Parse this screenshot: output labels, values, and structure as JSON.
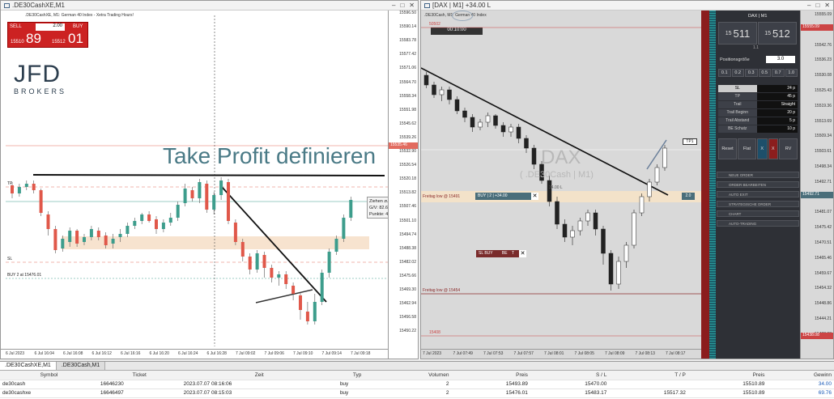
{
  "win1": {
    "title": ".DE30CashXE,M1",
    "info": ".DE30CashXE, M1: German 40 Index - Xetra Trading Hours!",
    "sell_label": "SELL",
    "buy_label": "BUY",
    "lot": "2.00",
    "sell_price_small": "15510",
    "sell_price_big": "89",
    "buy_price_small": "15512",
    "buy_price_big": "01",
    "logo_top": "JFD",
    "logo_bottom": "BROKERS",
    "overlay_text": "Take Profit definieren",
    "tooltip": [
      "Ziehen zum Ändern",
      "G/V: 82.62 EUR",
      "Punkte: 4131"
    ],
    "tp_label": "TP",
    "sl_label": "SL",
    "buy_line_label": "BUY 2 at 15476.01",
    "price_tag": "15535.46",
    "yticks": [
      "15596.50",
      "15590.14",
      "15583.78",
      "15577.42",
      "15571.06",
      "15564.70",
      "15558.34",
      "15551.98",
      "15545.62",
      "15539.26",
      "15532.90",
      "15526.54",
      "15520.18",
      "15513.82",
      "15507.46",
      "15501.10",
      "15494.74",
      "15488.38",
      "15482.02",
      "15475.66",
      "15469.30",
      "15462.94",
      "15456.58",
      "15450.22"
    ],
    "xticks": [
      "6 Jul 2023",
      "6 Jul 16:04",
      "6 Jul 16:08",
      "6 Jul 16:12",
      "6 Jul 16:16",
      "6 Jul 16:20",
      "6 Jul 16:24",
      "6 Jul 16:28",
      "7 Jul 09:02",
      "7 Jul 09:06",
      "7 Jul 09:10",
      "7 Jul 09:14",
      "7 Jul 09:18"
    ]
  },
  "win2": {
    "title": "[DAX | M1] +34.00 L",
    "info": ".DE30Cash, M1: German 40 Index",
    "timer": "00:10:00",
    "watermark_big": "DAX",
    "watermark_small": "( .DE30Cash | M1)",
    "line_top": "50502",
    "pos_label": "BUY | 2 | +34.00",
    "pos_right": "2.0",
    "pos_right2": "34.00 L",
    "sl_box": "SL BUY",
    "sl_box2": "BE",
    "t_label": "T",
    "tp_tag": "TP1",
    "day_low": "Freitag low @ 15491",
    "day_low2": "Freitag low @ 15454",
    "bottom_line": "15408",
    "yticks": [
      "15555.09",
      "15549.06",
      "15542.76",
      "15536.23",
      "15530.08",
      "15525.43",
      "15519.36",
      "15513.69",
      "15509.34",
      "15503.61",
      "15498.34",
      "15492.71",
      "15487.21",
      "15481.07",
      "15475.42",
      "15470.51",
      "15465.46",
      "15459.67",
      "15454.32",
      "15448.86",
      "15444.21",
      "15438.08"
    ],
    "ytag_top": "15555.09",
    "ytag_red": "15438.08",
    "ytag_blue": "15492.71",
    "xticks": [
      "7 Jul 2023",
      "7 Jul 07:49",
      "7 Jul 07:53",
      "7 Jul 07:57",
      "7 Jul 08:01",
      "7 Jul 08:05",
      "7 Jul 08:09",
      "7 Jul 08:13",
      "7 Jul 08:17"
    ]
  },
  "panel": {
    "symbol": "DAX | M1",
    "bid_small": "15",
    "bid_big": "511",
    "ask_small": "15",
    "ask_big": "512",
    "spread": "1.1",
    "size_label": "Positionsgröße",
    "size_val": "3.0",
    "lots": [
      "0.1",
      "0.2",
      "0.3",
      "0.5",
      "0.7",
      "1.0"
    ],
    "params": [
      {
        "k": "SL",
        "v": "24 p"
      },
      {
        "k": "TP",
        "v": "45 p"
      },
      {
        "k": "Trail",
        "v": "Straight"
      },
      {
        "k": "Trail Beginn",
        "v": "20 p"
      },
      {
        "k": "Trail Abstand",
        "v": "5 p"
      },
      {
        "k": "BE Schutz",
        "v": "10 p"
      }
    ],
    "buttons": [
      "Reset",
      "Flat",
      "X",
      "X",
      "RV"
    ],
    "menus": [
      "NEUE ORDER",
      "ORDER BEARBEITEN",
      "AUTO EXIT",
      "STRATEGISCHE ORDER",
      "CHART",
      "AUTO-TRADING"
    ]
  },
  "tabs": [
    ".DE30CashXE,M1",
    ".DE30Cash,M1"
  ],
  "table": {
    "headers": [
      "Symbol",
      "Ticket",
      "Zeit",
      "Typ",
      "Volumen",
      "Preis",
      "S / L",
      "T / P",
      "Preis",
      "Gewinn"
    ],
    "rows": [
      [
        "de30cash",
        "16646230",
        "2023.07.07 08:16:06",
        "buy",
        "2",
        "15493.89",
        "15470.00",
        "",
        "15510.89",
        "34.00"
      ],
      [
        "de30cashxe",
        "16646497",
        "2023.07.07 08:15:03",
        "buy",
        "2",
        "15476.01",
        "15483.17",
        "15517.32",
        "15510.89",
        "69.76"
      ]
    ]
  },
  "colors": {
    "up": "#3d9d8c",
    "down": "#e0584a",
    "accent": "#4a7a86",
    "band": "#f7e3cf"
  }
}
